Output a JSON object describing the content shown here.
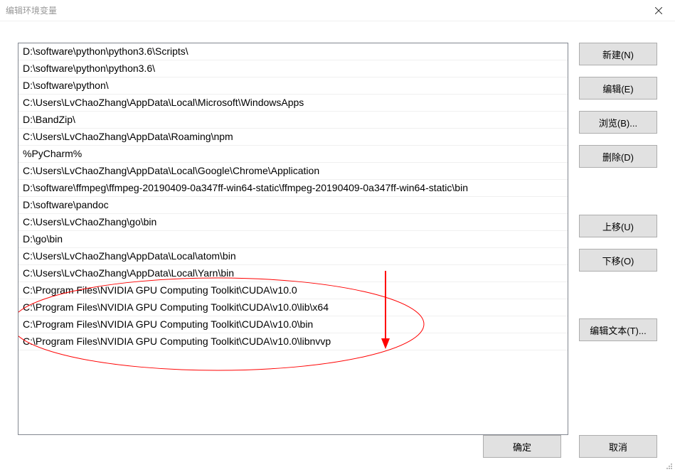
{
  "window": {
    "title": "编辑环境变量"
  },
  "paths": [
    "D:\\software\\python\\python3.6\\Scripts\\",
    "D:\\software\\python\\python3.6\\",
    "D:\\software\\python\\",
    "C:\\Users\\LvChaoZhang\\AppData\\Local\\Microsoft\\WindowsApps",
    "D:\\BandZip\\",
    "C:\\Users\\LvChaoZhang\\AppData\\Roaming\\npm",
    "%PyCharm%",
    "C:\\Users\\LvChaoZhang\\AppData\\Local\\Google\\Chrome\\Application",
    "D:\\software\\ffmpeg\\ffmpeg-20190409-0a347ff-win64-static\\ffmpeg-20190409-0a347ff-win64-static\\bin",
    "D:\\software\\pandoc",
    "C:\\Users\\LvChaoZhang\\go\\bin",
    "D:\\go\\bin",
    "C:\\Users\\LvChaoZhang\\AppData\\Local\\atom\\bin",
    "C:\\Users\\LvChaoZhang\\AppData\\Local\\Yarn\\bin",
    "C:\\Program Files\\NVIDIA GPU Computing Toolkit\\CUDA\\v10.0",
    "C:\\Program Files\\NVIDIA GPU Computing Toolkit\\CUDA\\v10.0\\lib\\x64",
    "C:\\Program Files\\NVIDIA GPU Computing Toolkit\\CUDA\\v10.0\\bin",
    "C:\\Program Files\\NVIDIA GPU Computing Toolkit\\CUDA\\v10.0\\libnvvp"
  ],
  "buttons": {
    "new": "新建(N)",
    "edit": "编辑(E)",
    "browse": "浏览(B)...",
    "delete": "删除(D)",
    "moveUp": "上移(U)",
    "moveDown": "下移(O)",
    "editText": "编辑文本(T)...",
    "ok": "确定",
    "cancel": "取消"
  }
}
